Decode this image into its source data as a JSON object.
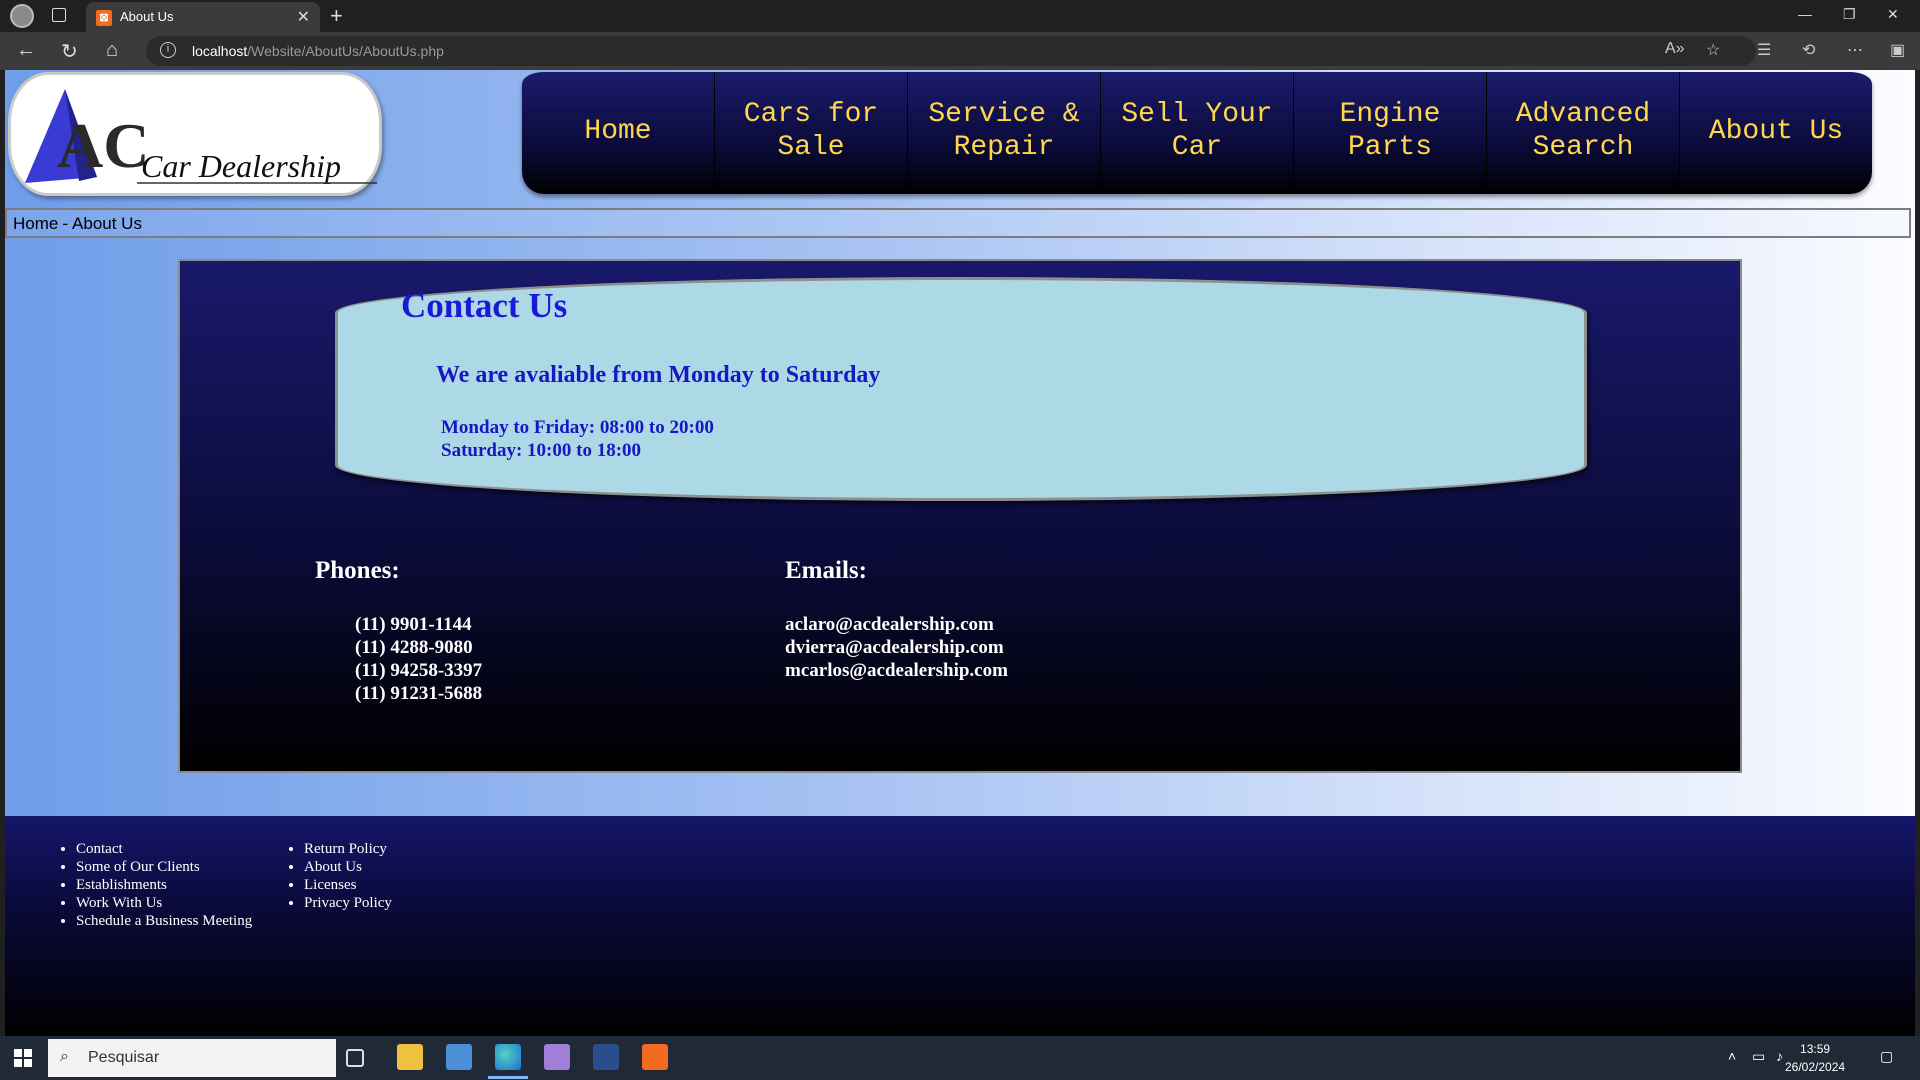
{
  "browser": {
    "tab_title": "About Us",
    "url_host": "localhost",
    "url_path": "/Website/AboutUs/AboutUs.php"
  },
  "logo": {
    "letters": "AC",
    "text": "Car Dealership"
  },
  "nav": {
    "items": [
      {
        "label": "Home"
      },
      {
        "label": "Cars for Sale"
      },
      {
        "label": "Service & Repair"
      },
      {
        "label": "Sell Your Car"
      },
      {
        "label": "Engine Parts"
      },
      {
        "label": "Advanced Search"
      },
      {
        "label": "About Us"
      }
    ]
  },
  "breadcrumb": {
    "home": "Home",
    "separator": "-",
    "current": "About Us"
  },
  "contact": {
    "title": "Contact Us",
    "subtitle": "We are avaliable from Monday to Saturday",
    "hours": [
      "Monday to Friday: 08:00 to 20:00",
      "Saturday: 10:00 to 18:00"
    ]
  },
  "phones": {
    "title": "Phones:",
    "list": [
      "(11) 9901-1144",
      "(11) 4288-9080",
      "(11) 94258-3397",
      "(11) 91231-5688"
    ]
  },
  "emails": {
    "title": "Emails:",
    "list": [
      "aclaro@acdealership.com",
      "dvierra@acdealership.com",
      "mcarlos@acdealership.com"
    ]
  },
  "footer": {
    "col1": [
      "Contact",
      "Some of Our Clients",
      "Establishments",
      "Work With Us",
      "Schedule a Business Meeting"
    ],
    "col2": [
      "Return Policy",
      "About Us",
      "Licenses",
      "Privacy Policy"
    ]
  },
  "taskbar": {
    "search_placeholder": "Pesquisar",
    "time": "13:59",
    "date": "26/02/2024"
  }
}
